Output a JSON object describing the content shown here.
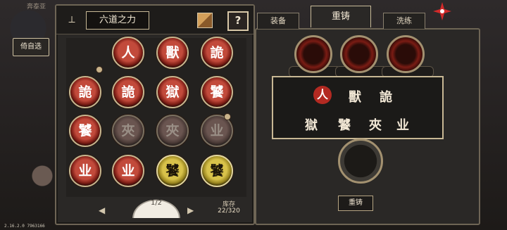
{
  "background": {
    "top_name": "奔泰亚"
  },
  "version_text": "2.16.2.0 7963166",
  "left_panel": {
    "title": "六道之力",
    "only_self_label": "倚自选",
    "page": "1/2",
    "stock_label": "库存",
    "stock_value": "22/320",
    "coins": [
      [
        "人",
        "獸",
        "詭"
      ],
      [
        "詭",
        "詭",
        "獄",
        "饕"
      ],
      [
        "饕",
        "夾",
        "夾",
        "业"
      ],
      [
        "业",
        "业",
        "饕",
        "饕"
      ]
    ]
  },
  "right_panel": {
    "tabs": [
      "装备",
      "重铸",
      "洗练"
    ],
    "active_tab": "重铸",
    "row1": [
      "人",
      "獸",
      "詭"
    ],
    "row2": [
      "獄",
      "饕",
      "夾",
      "业"
    ],
    "recast_label": "重铸"
  },
  "colors": {
    "accent_red": "#b32a22",
    "gold": "#d8c24a",
    "frame": "#6e6555"
  }
}
